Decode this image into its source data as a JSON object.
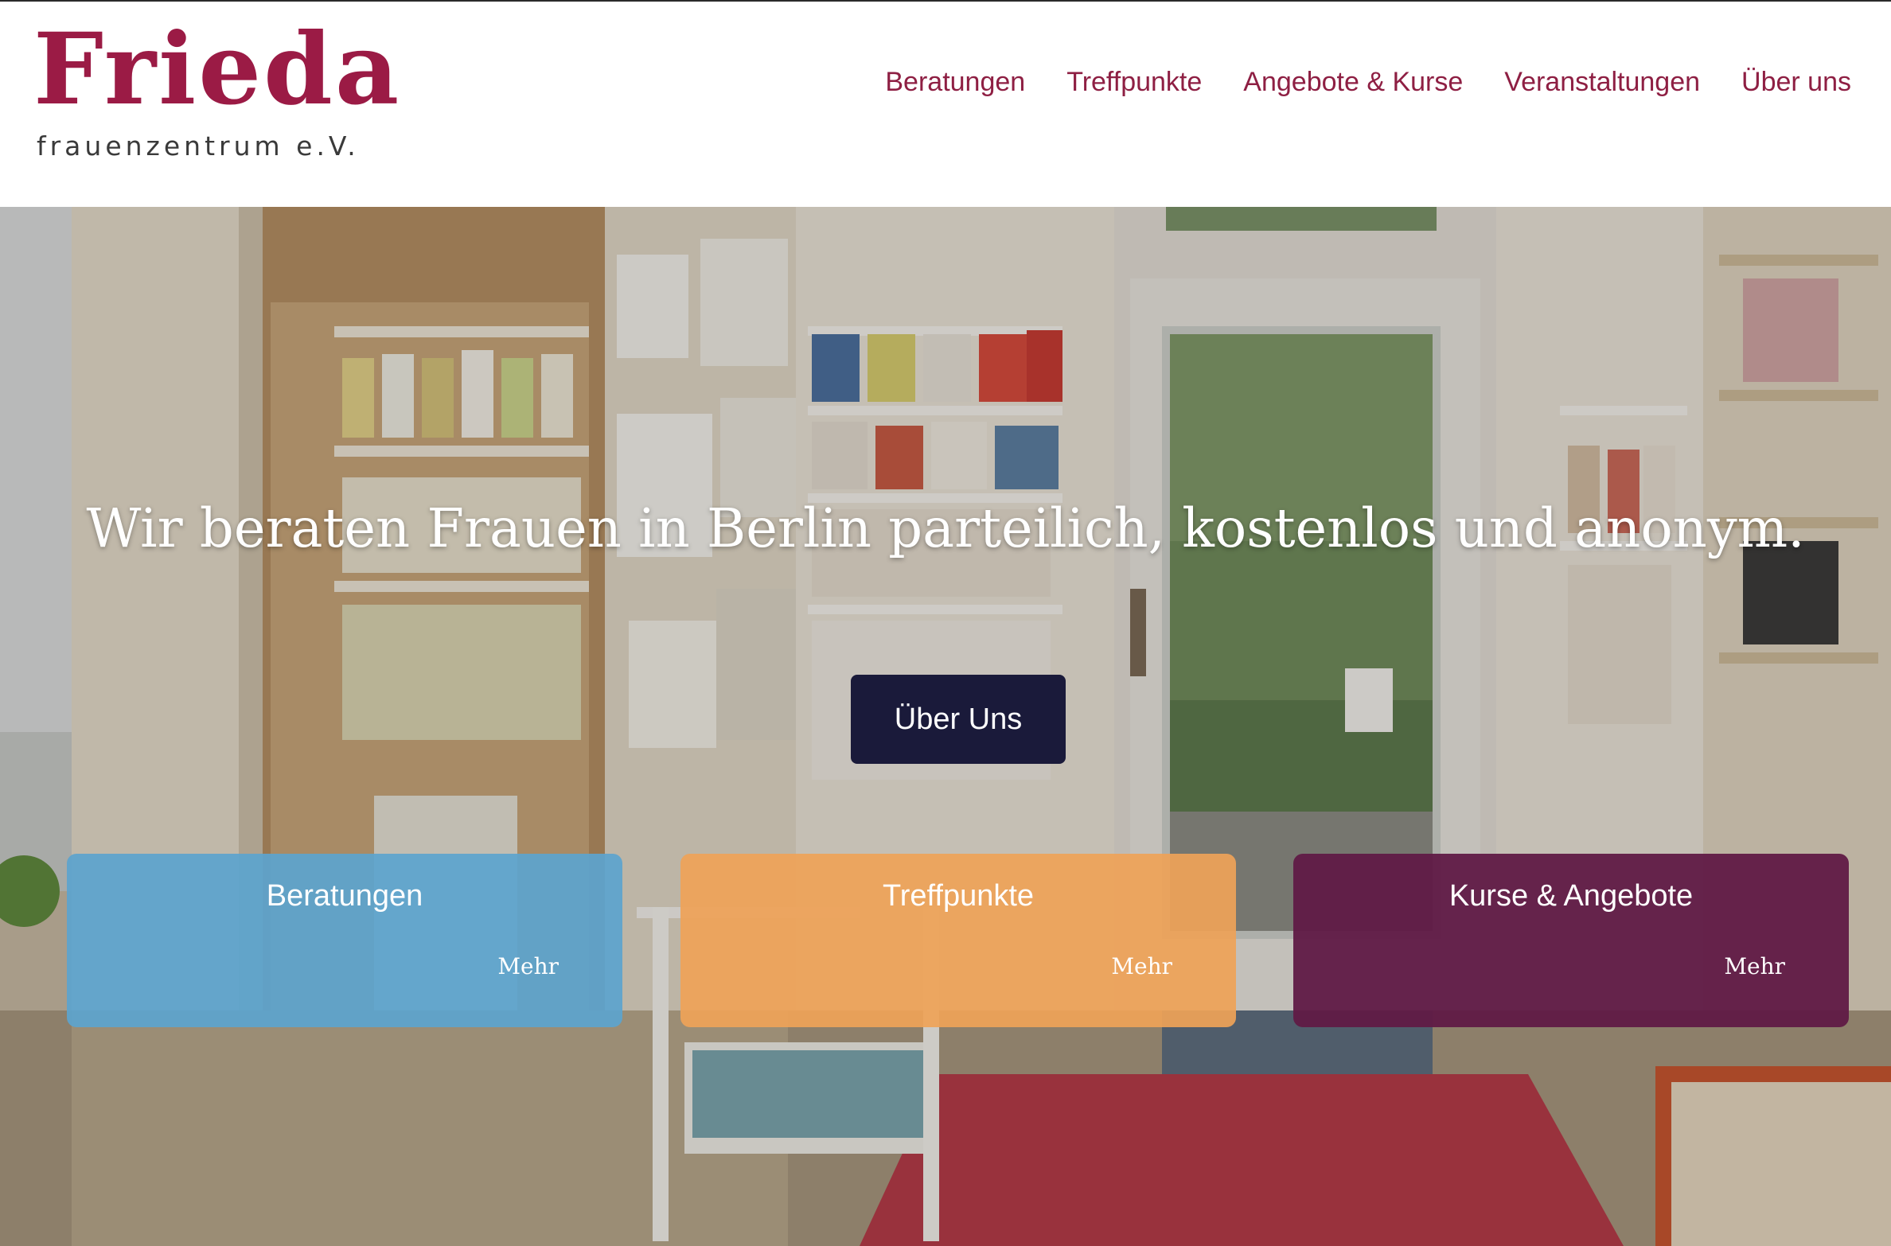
{
  "header": {
    "logo_word": "Frieda",
    "logo_sub": "frauenzentrum e.V.",
    "nav": [
      "Beratungen",
      "Treffpunkte",
      "Angebote & Kurse",
      "Veranstaltungen",
      "Über uns"
    ]
  },
  "hero": {
    "headline": "Wir beraten Frauen in Berlin parteilich, kostenlos und anonym.",
    "cta_label": "Über Uns",
    "cards": [
      {
        "title": "Beratungen",
        "more": "Mehr",
        "color": "#5ca4cd"
      },
      {
        "title": "Treffpunkte",
        "more": "Mehr",
        "color": "#eea258"
      },
      {
        "title": "Kurse & Angebote",
        "more": "Mehr",
        "color": "#601a46"
      }
    ]
  },
  "colors": {
    "brand": "#9b1b45",
    "nav_text": "#8e1f43",
    "cta_bg": "#1a1a3a"
  }
}
